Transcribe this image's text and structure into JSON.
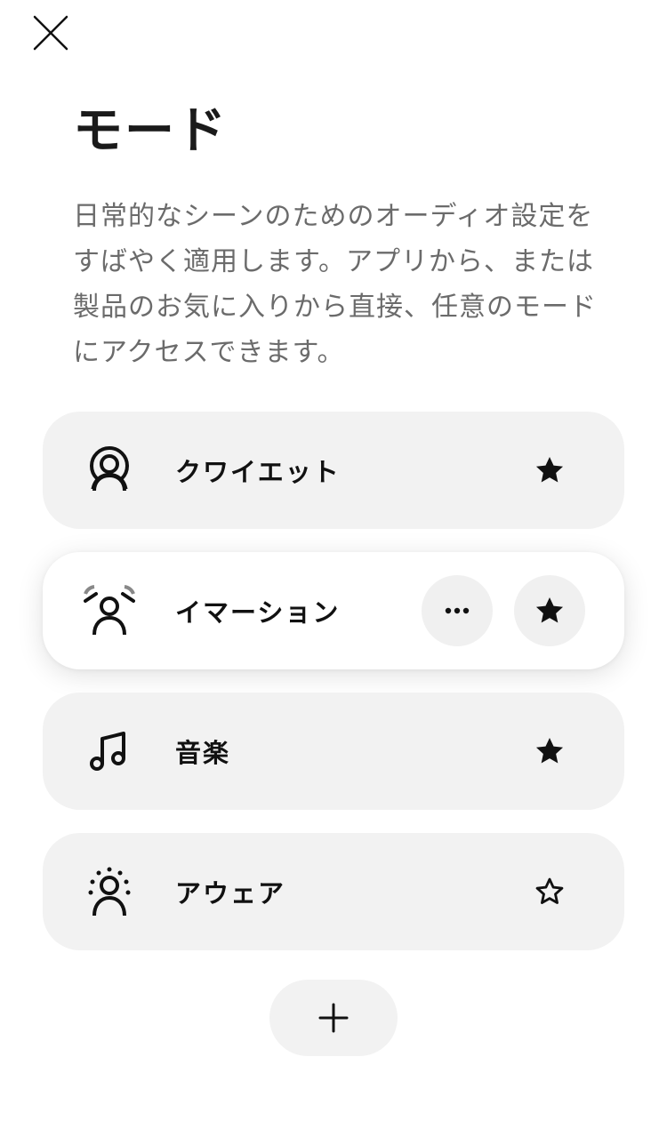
{
  "header": {
    "close_icon": "close-icon",
    "title": "モード",
    "description": "日常的なシーンのためのオーディオ設定をすばやく適用します。アプリから、または製品のお気に入りから直接、任意のモードにアクセスできます。"
  },
  "modes": [
    {
      "label": "クワイエット",
      "icon": "quiet-person-icon",
      "favorite": true,
      "active": false
    },
    {
      "label": "イマーション",
      "icon": "immersion-person-icon",
      "favorite": true,
      "active": true
    },
    {
      "label": "音楽",
      "icon": "music-note-icon",
      "favorite": true,
      "active": false
    },
    {
      "label": "アウェア",
      "icon": "aware-person-icon",
      "favorite": false,
      "active": false
    }
  ],
  "actions": {
    "more_icon": "more-dots-icon",
    "add_icon": "plus-icon"
  },
  "colors": {
    "background": "#ffffff",
    "card_background": "#f2f2f2",
    "active_card_background": "#ffffff",
    "text_primary": "#111111",
    "text_secondary": "#6b6b6b"
  }
}
